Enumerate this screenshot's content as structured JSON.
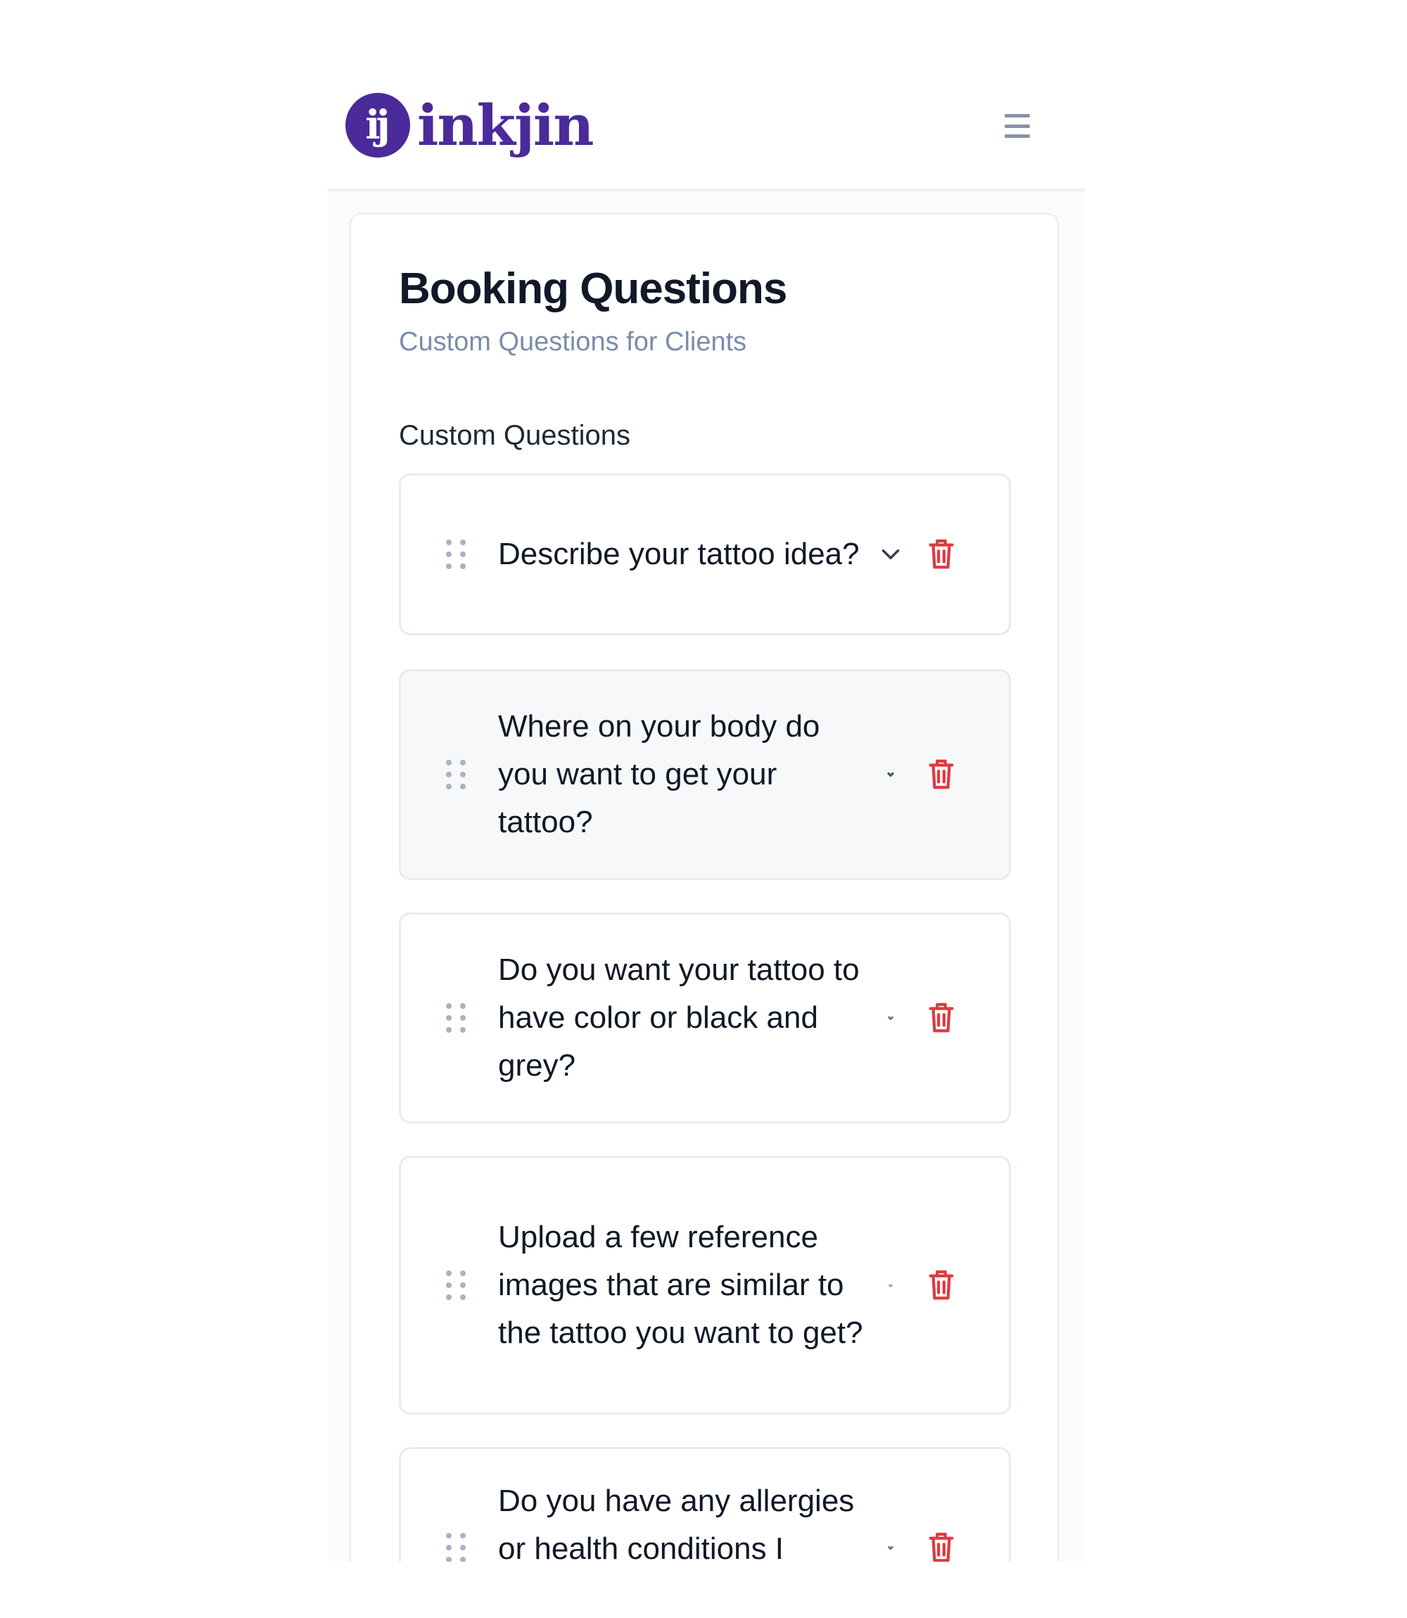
{
  "header": {
    "logo_mark": "ij",
    "logo_text": "inkjin",
    "menu_icon": "hamburger-menu-icon"
  },
  "page": {
    "title": "Booking Questions",
    "subtitle": "Custom Questions for Clients",
    "section_label": "Custom Questions"
  },
  "questions": [
    {
      "text": "Describe your tattoo idea?"
    },
    {
      "text": "Where on your body do you want to get your tattoo?"
    },
    {
      "text": "Do you want your tattoo to have color or black and grey?"
    },
    {
      "text": "Upload a few reference images that are similar to the tattoo you want to get?"
    },
    {
      "text": "Do you have any allergies or health conditions I"
    }
  ],
  "icons": {
    "drag": "drag-handle-icon",
    "expand": "chevron-down-icon",
    "delete": "trash-icon"
  },
  "colors": {
    "brand": "#4b2a9a",
    "delete": "#e0393e",
    "subtitle": "#7b8cab"
  }
}
